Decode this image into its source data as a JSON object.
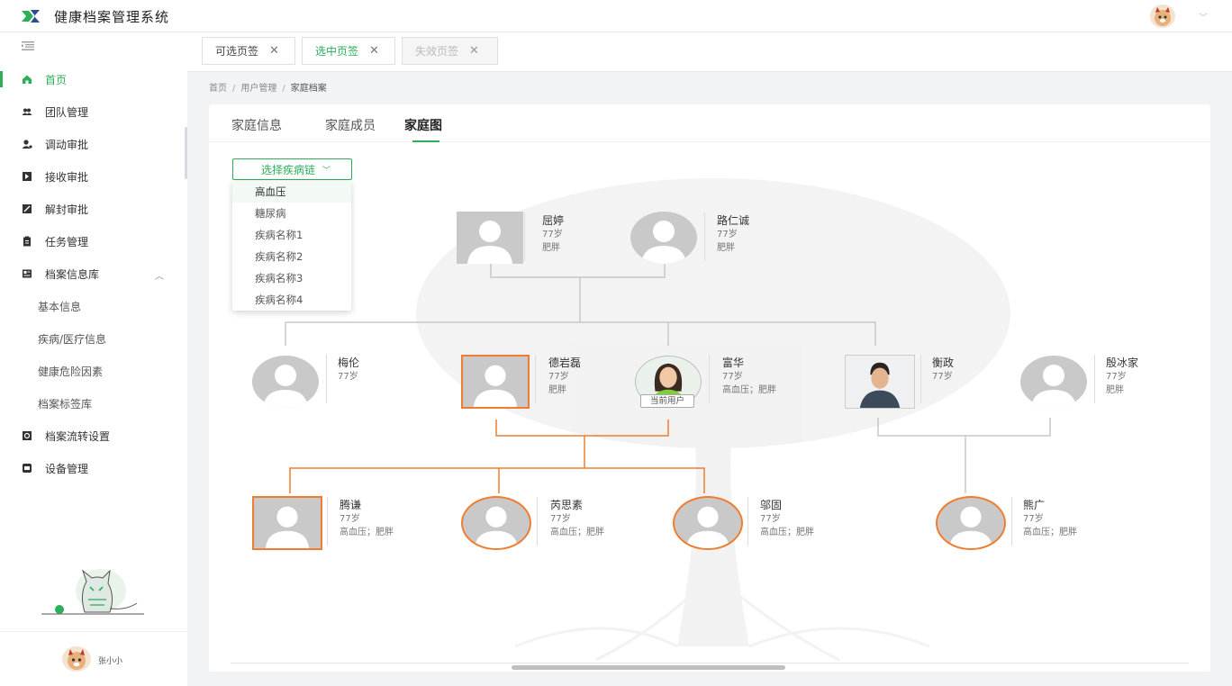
{
  "app": {
    "title": "健康档案管理系统"
  },
  "sidebar": {
    "menu": [
      {
        "label": "首页",
        "icon": "home-icon",
        "active": true
      },
      {
        "label": "团队管理",
        "icon": "team-icon"
      },
      {
        "label": "调动审批",
        "icon": "transfer-icon"
      },
      {
        "label": "接收审批",
        "icon": "receive-icon"
      },
      {
        "label": "解封审批",
        "icon": "unseal-icon"
      },
      {
        "label": "任务管理",
        "icon": "task-icon"
      },
      {
        "label": "档案信息库",
        "icon": "archive-icon",
        "expanded": true
      },
      {
        "label": "档案流转设置",
        "icon": "flow-icon"
      },
      {
        "label": "设备管理",
        "icon": "device-icon"
      }
    ],
    "submenu": [
      "基本信息",
      "疾病/医疗信息",
      "健康危险因素",
      "档案标签库"
    ],
    "user": {
      "name": "张小小"
    }
  },
  "page_tabs": [
    {
      "label": "可选页签",
      "state": "normal"
    },
    {
      "label": "选中页签",
      "state": "selected"
    },
    {
      "label": "失效页签",
      "state": "disabled"
    }
  ],
  "breadcrumb": [
    "首页",
    "用户管理",
    "家庭档案"
  ],
  "content_tabs": [
    "家庭信息",
    "家庭成员",
    "家庭图"
  ],
  "disease_select": {
    "label": "选择疾病链",
    "options": [
      "高血压",
      "糖尿病",
      "疾病名称1",
      "疾病名称2",
      "疾病名称3",
      "疾病名称4"
    ]
  },
  "family_tree": {
    "current_user_badge": "当前用户",
    "members": [
      {
        "id": "m1",
        "name": "屈婷",
        "age": "77岁",
        "tags": "肥胖"
      },
      {
        "id": "m2",
        "name": "路仁诚",
        "age": "77岁",
        "tags": "肥胖"
      },
      {
        "id": "m3",
        "name": "梅伦",
        "age": "77岁",
        "tags": ""
      },
      {
        "id": "m4",
        "name": "德岩磊",
        "age": "77岁",
        "tags": "肥胖"
      },
      {
        "id": "m5",
        "name": "富华",
        "age": "77岁",
        "tags": "高血压；肥胖"
      },
      {
        "id": "m6",
        "name": "衡政",
        "age": "77岁",
        "tags": ""
      },
      {
        "id": "m7",
        "name": "殷冰家",
        "age": "77岁",
        "tags": "肥胖"
      },
      {
        "id": "m8",
        "name": "腾谦",
        "age": "77岁",
        "tags": "高血压；肥胖"
      },
      {
        "id": "m9",
        "name": "芮思素",
        "age": "77岁",
        "tags": "高血压；肥胖"
      },
      {
        "id": "m10",
        "name": "邬固",
        "age": "77岁",
        "tags": "高血压；肥胖"
      },
      {
        "id": "m11",
        "name": "熊广",
        "age": "77岁",
        "tags": "高血压；肥胖"
      }
    ]
  },
  "colors": {
    "accent": "#2fae5a",
    "highlight": "#ef7d2f"
  }
}
